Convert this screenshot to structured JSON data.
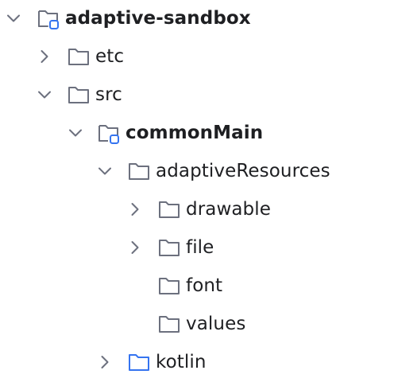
{
  "tree": {
    "root": {
      "label": "adaptive-sandbox",
      "expanded": true,
      "icon": "module-folder-icon"
    },
    "etc": {
      "label": "etc",
      "expanded": false,
      "icon": "folder-icon"
    },
    "src": {
      "label": "src",
      "expanded": true,
      "icon": "folder-icon"
    },
    "commonMain": {
      "label": "commonMain",
      "expanded": true,
      "icon": "source-set-folder-icon"
    },
    "adaptiveResources": {
      "label": "adaptiveResources",
      "expanded": true,
      "icon": "folder-icon"
    },
    "drawable": {
      "label": "drawable",
      "expanded": false,
      "icon": "folder-icon"
    },
    "file": {
      "label": "file",
      "expanded": false,
      "icon": "folder-icon"
    },
    "font": {
      "label": "font",
      "icon": "folder-icon"
    },
    "values": {
      "label": "values",
      "icon": "folder-icon"
    },
    "kotlin": {
      "label": "kotlin",
      "expanded": false,
      "icon": "source-root-folder-icon"
    }
  },
  "colors": {
    "text": "#1e1f22",
    "icon_gray": "#6c707e",
    "icon_blue": "#3574f0"
  }
}
